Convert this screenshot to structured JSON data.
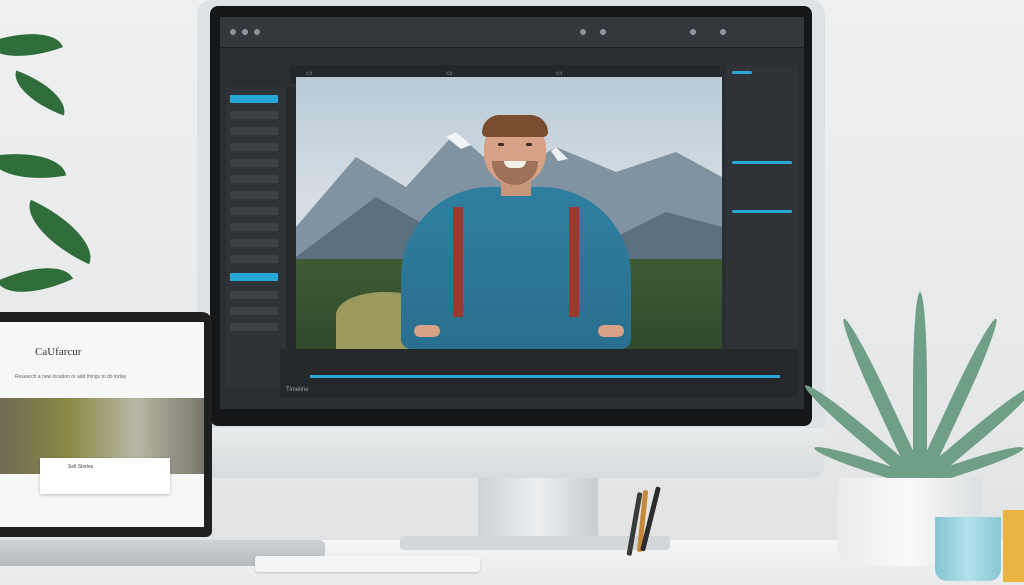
{
  "laptop": {
    "heading": "CaUfarcur",
    "subtitle": "Research a new location or add things to do today",
    "card_text": "Sell Stories"
  },
  "monitor": {
    "timeline_label": "Timeline"
  },
  "colors": {
    "accent": "#2aa7d6",
    "editor_bg": "#2a2d31",
    "jacket": "#2f7fa1"
  }
}
